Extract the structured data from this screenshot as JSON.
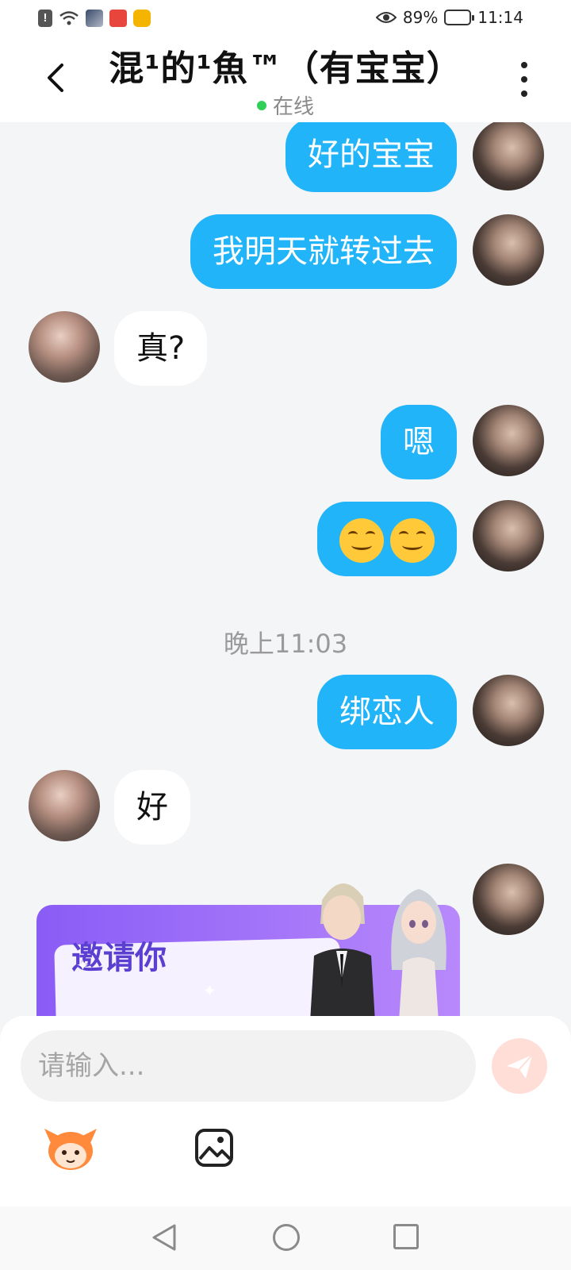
{
  "status_bar": {
    "battery": "89%",
    "time": "11:14"
  },
  "header": {
    "title": "混¹的¹魚™（有宝宝）",
    "presence": "在线"
  },
  "messages": [
    {
      "from": "me",
      "text": "好的宝宝"
    },
    {
      "from": "me",
      "text": "我明天就转过去"
    },
    {
      "from": "her",
      "text": "真?"
    },
    {
      "from": "me",
      "text": "嗯"
    },
    {
      "from": "me",
      "emoji": [
        "smiling-face",
        "smiling-face"
      ]
    },
    {
      "from": "me",
      "text": "绑恋人"
    },
    {
      "from": "her",
      "text": "好"
    }
  ],
  "timestamp": "晚上11:03",
  "invite_card": {
    "text": "邀请你"
  },
  "composer": {
    "placeholder": "请输入..."
  },
  "colors": {
    "outgoing_bubble": "#22b4f8",
    "incoming_bubble": "#ffffff",
    "background": "#f4f5f7",
    "online_dot": "#2fcf58",
    "send_button": "#ffded8",
    "invite_card": "#8a5cf6"
  },
  "icons": {
    "back": "chevron-left-icon",
    "more": "more-vertical-icon",
    "send": "send-icon",
    "sticker": "mascot-sticker-icon",
    "gallery": "image-icon"
  }
}
